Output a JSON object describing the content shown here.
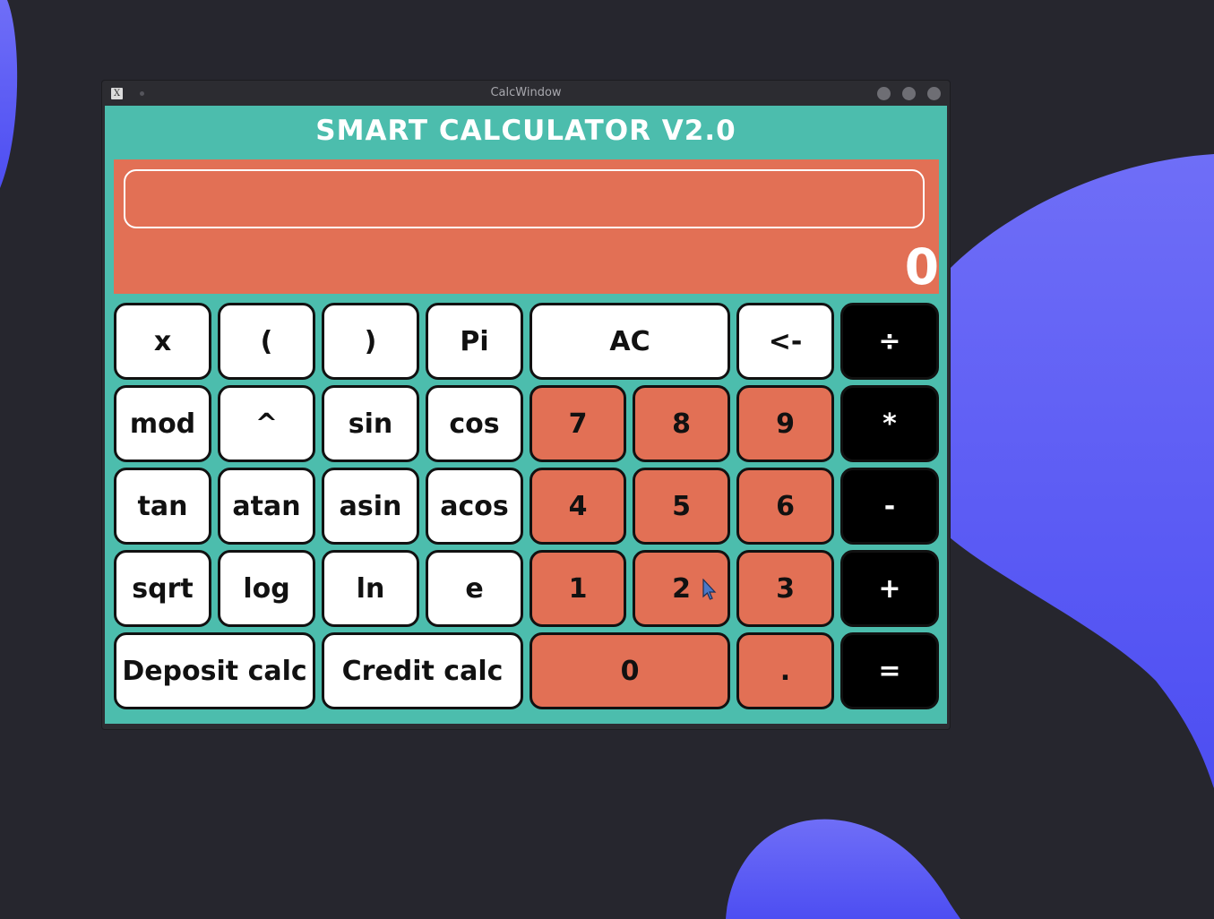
{
  "window": {
    "title": "CalcWindow",
    "app_icon": "X"
  },
  "app": {
    "title": "SMART CALCULATOR V2.0",
    "expression_value": "",
    "result": "0"
  },
  "buttons": {
    "x": "x",
    "lparen": "(",
    "rparen": ")",
    "pi": "Pi",
    "ac": "AC",
    "backspace": "<-",
    "divide": "÷",
    "mod": "mod",
    "pow": "^",
    "sin": "sin",
    "cos": "cos",
    "n7": "7",
    "n8": "8",
    "n9": "9",
    "multiply": "*",
    "tan": "tan",
    "atan": "atan",
    "asin": "asin",
    "acos": "acos",
    "n4": "4",
    "n5": "5",
    "n6": "6",
    "minus": "-",
    "sqrt": "sqrt",
    "log": "log",
    "ln": "ln",
    "e": "e",
    "n1": "1",
    "n2": "2",
    "n3": "3",
    "plus": "+",
    "deposit": "Deposit calc",
    "credit": "Credit calc",
    "n0": "0",
    "dot": ".",
    "equals": "="
  },
  "colors": {
    "background": "#4cbdad",
    "display": "#e27055",
    "digit_button": "#e27055",
    "function_button": "#ffffff",
    "operator_button": "#000000",
    "desktop_blob": "#5b5cf5"
  }
}
